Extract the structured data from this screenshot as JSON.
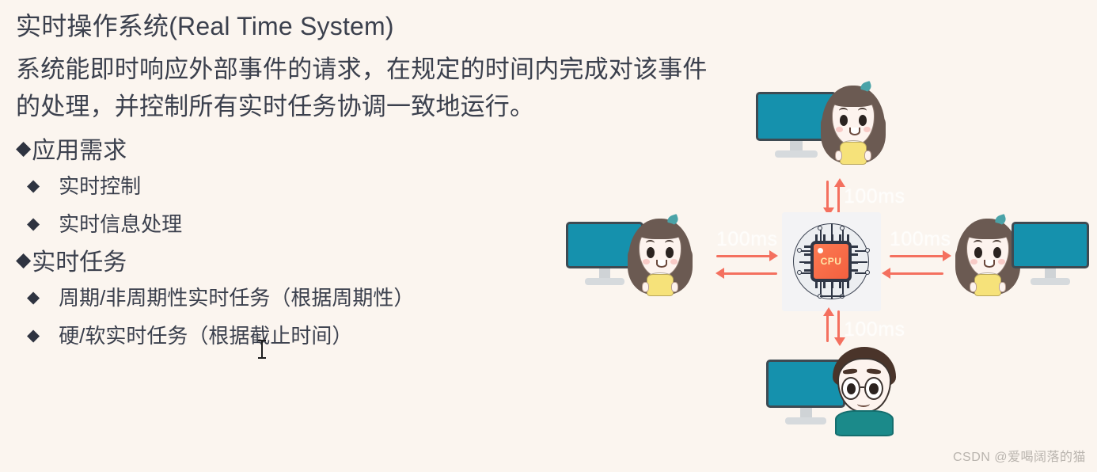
{
  "slide": {
    "title": "实时操作系统(Real Time System)",
    "paragraph_lines": [
      "系统能即时响应外部事件的请求，在规定的时间内完成对该事件",
      "的处理，并控制所有实时任务协调一致地运行。"
    ],
    "bullets": [
      {
        "level": 1,
        "marker": "◆",
        "label": "应用需求"
      },
      {
        "level": 2,
        "marker": "◆",
        "label": "实时控制"
      },
      {
        "level": 2,
        "marker": "◆",
        "label": "实时信息处理"
      },
      {
        "level": 1,
        "marker": "◆",
        "label": "实时任务"
      },
      {
        "level": 2,
        "marker": "◆",
        "label": "周期/非周期性实时任务（根据周期性）"
      },
      {
        "level": 2,
        "marker": "◆",
        "label": "硬/软实时任务（根据截止时间）"
      }
    ]
  },
  "diagram": {
    "center": {
      "label": "CPU",
      "icon": "cpu-chip-icon"
    },
    "nodes": [
      {
        "id": "top",
        "icon": "monitor-and-girl-avatar",
        "latency": "100ms"
      },
      {
        "id": "left",
        "icon": "monitor-and-girl-avatar",
        "latency": "100ms"
      },
      {
        "id": "right",
        "icon": "girl-avatar-and-monitor",
        "latency": "100ms"
      },
      {
        "id": "bottom",
        "icon": "monitor-and-boy-avatar",
        "latency": "100ms"
      }
    ]
  },
  "watermark": "CSDN @爱喝阔落的猫",
  "colors": {
    "background": "#fbf5ef",
    "text": "#3b404d",
    "arrow": "#f4705f",
    "screen": "#1591ad",
    "chip": "#f4603f",
    "panel": "#f3f3f5",
    "watermark": "#b9b4ae"
  }
}
